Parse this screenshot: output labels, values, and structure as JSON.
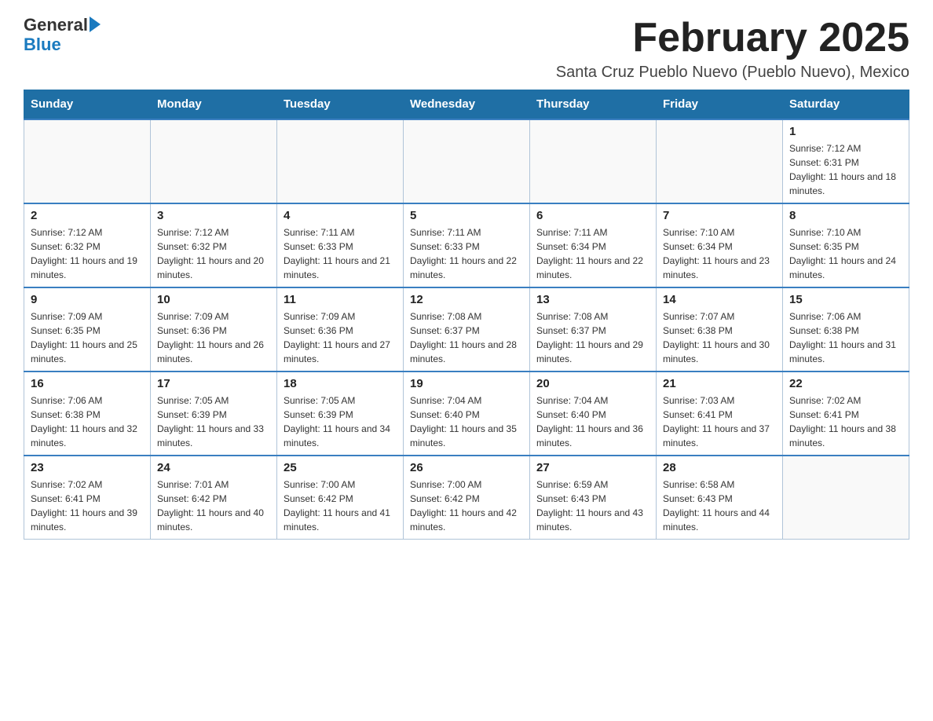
{
  "header": {
    "logo_general": "General",
    "logo_blue": "Blue",
    "month_title": "February 2025",
    "location": "Santa Cruz Pueblo Nuevo (Pueblo Nuevo), Mexico"
  },
  "days_of_week": [
    "Sunday",
    "Monday",
    "Tuesday",
    "Wednesday",
    "Thursday",
    "Friday",
    "Saturday"
  ],
  "weeks": [
    [
      {
        "day": "",
        "info": ""
      },
      {
        "day": "",
        "info": ""
      },
      {
        "day": "",
        "info": ""
      },
      {
        "day": "",
        "info": ""
      },
      {
        "day": "",
        "info": ""
      },
      {
        "day": "",
        "info": ""
      },
      {
        "day": "1",
        "info": "Sunrise: 7:12 AM\nSunset: 6:31 PM\nDaylight: 11 hours and 18 minutes."
      }
    ],
    [
      {
        "day": "2",
        "info": "Sunrise: 7:12 AM\nSunset: 6:32 PM\nDaylight: 11 hours and 19 minutes."
      },
      {
        "day": "3",
        "info": "Sunrise: 7:12 AM\nSunset: 6:32 PM\nDaylight: 11 hours and 20 minutes."
      },
      {
        "day": "4",
        "info": "Sunrise: 7:11 AM\nSunset: 6:33 PM\nDaylight: 11 hours and 21 minutes."
      },
      {
        "day": "5",
        "info": "Sunrise: 7:11 AM\nSunset: 6:33 PM\nDaylight: 11 hours and 22 minutes."
      },
      {
        "day": "6",
        "info": "Sunrise: 7:11 AM\nSunset: 6:34 PM\nDaylight: 11 hours and 22 minutes."
      },
      {
        "day": "7",
        "info": "Sunrise: 7:10 AM\nSunset: 6:34 PM\nDaylight: 11 hours and 23 minutes."
      },
      {
        "day": "8",
        "info": "Sunrise: 7:10 AM\nSunset: 6:35 PM\nDaylight: 11 hours and 24 minutes."
      }
    ],
    [
      {
        "day": "9",
        "info": "Sunrise: 7:09 AM\nSunset: 6:35 PM\nDaylight: 11 hours and 25 minutes."
      },
      {
        "day": "10",
        "info": "Sunrise: 7:09 AM\nSunset: 6:36 PM\nDaylight: 11 hours and 26 minutes."
      },
      {
        "day": "11",
        "info": "Sunrise: 7:09 AM\nSunset: 6:36 PM\nDaylight: 11 hours and 27 minutes."
      },
      {
        "day": "12",
        "info": "Sunrise: 7:08 AM\nSunset: 6:37 PM\nDaylight: 11 hours and 28 minutes."
      },
      {
        "day": "13",
        "info": "Sunrise: 7:08 AM\nSunset: 6:37 PM\nDaylight: 11 hours and 29 minutes."
      },
      {
        "day": "14",
        "info": "Sunrise: 7:07 AM\nSunset: 6:38 PM\nDaylight: 11 hours and 30 minutes."
      },
      {
        "day": "15",
        "info": "Sunrise: 7:06 AM\nSunset: 6:38 PM\nDaylight: 11 hours and 31 minutes."
      }
    ],
    [
      {
        "day": "16",
        "info": "Sunrise: 7:06 AM\nSunset: 6:38 PM\nDaylight: 11 hours and 32 minutes."
      },
      {
        "day": "17",
        "info": "Sunrise: 7:05 AM\nSunset: 6:39 PM\nDaylight: 11 hours and 33 minutes."
      },
      {
        "day": "18",
        "info": "Sunrise: 7:05 AM\nSunset: 6:39 PM\nDaylight: 11 hours and 34 minutes."
      },
      {
        "day": "19",
        "info": "Sunrise: 7:04 AM\nSunset: 6:40 PM\nDaylight: 11 hours and 35 minutes."
      },
      {
        "day": "20",
        "info": "Sunrise: 7:04 AM\nSunset: 6:40 PM\nDaylight: 11 hours and 36 minutes."
      },
      {
        "day": "21",
        "info": "Sunrise: 7:03 AM\nSunset: 6:41 PM\nDaylight: 11 hours and 37 minutes."
      },
      {
        "day": "22",
        "info": "Sunrise: 7:02 AM\nSunset: 6:41 PM\nDaylight: 11 hours and 38 minutes."
      }
    ],
    [
      {
        "day": "23",
        "info": "Sunrise: 7:02 AM\nSunset: 6:41 PM\nDaylight: 11 hours and 39 minutes."
      },
      {
        "day": "24",
        "info": "Sunrise: 7:01 AM\nSunset: 6:42 PM\nDaylight: 11 hours and 40 minutes."
      },
      {
        "day": "25",
        "info": "Sunrise: 7:00 AM\nSunset: 6:42 PM\nDaylight: 11 hours and 41 minutes."
      },
      {
        "day": "26",
        "info": "Sunrise: 7:00 AM\nSunset: 6:42 PM\nDaylight: 11 hours and 42 minutes."
      },
      {
        "day": "27",
        "info": "Sunrise: 6:59 AM\nSunset: 6:43 PM\nDaylight: 11 hours and 43 minutes."
      },
      {
        "day": "28",
        "info": "Sunrise: 6:58 AM\nSunset: 6:43 PM\nDaylight: 11 hours and 44 minutes."
      },
      {
        "day": "",
        "info": ""
      }
    ]
  ]
}
